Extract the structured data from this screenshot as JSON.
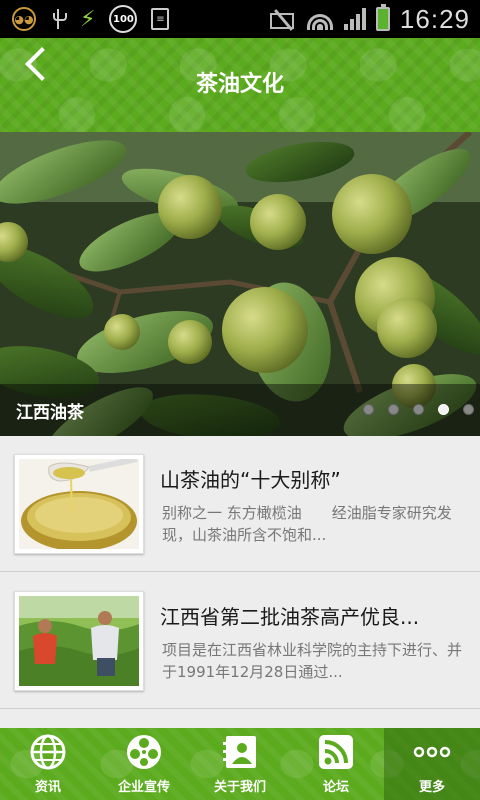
{
  "status_bar": {
    "time": "16:29",
    "battery_badge": "100",
    "left_icons": [
      "cat-notification-icon",
      "usb-icon",
      "charging-bolt-icon",
      "battery-100-badge-icon",
      "document-icon"
    ],
    "right_icons": [
      "mute-icon",
      "wifi-icon",
      "signal-icon",
      "battery-charging-icon"
    ]
  },
  "header": {
    "title": "茶油文化",
    "back_icon": "back-chevron-icon",
    "color": "#5cab1f"
  },
  "banner": {
    "caption": "江西油茶",
    "slide_count": 5,
    "active_slide": 4
  },
  "news": [
    {
      "title": "山茶油的“十大别称”",
      "desc": "别称之一 东方橄榄油　　经油脂专家研究发现，山茶油所含不饱和..."
    },
    {
      "title": "江西省第二批油茶高产优良...",
      "desc": "项目是在江西省林业科学院的主持下进行、并于1991年12月28日通过..."
    }
  ],
  "bottom_nav": {
    "items": [
      {
        "label": "资讯",
        "icon": "globe-icon"
      },
      {
        "label": "企业宣传",
        "icon": "film-reel-icon"
      },
      {
        "label": "关于我们",
        "icon": "contact-card-icon"
      },
      {
        "label": "论坛",
        "icon": "rss-feed-icon"
      },
      {
        "label": "更多",
        "icon": "more-dots-icon"
      }
    ],
    "active_index": 4
  }
}
